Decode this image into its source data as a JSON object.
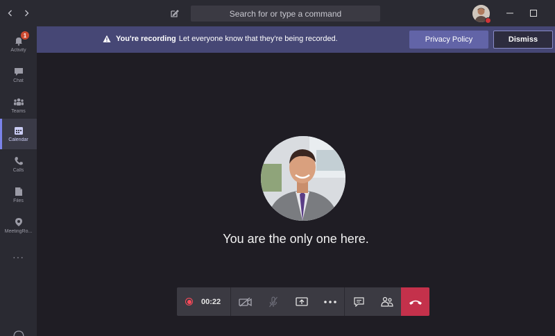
{
  "titlebar": {
    "search_placeholder": "Search for or type a command"
  },
  "rail": {
    "items": [
      {
        "label": "Activity",
        "icon": "bell-icon",
        "badge": "1"
      },
      {
        "label": "Chat",
        "icon": "chat-icon"
      },
      {
        "label": "Teams",
        "icon": "teams-icon"
      },
      {
        "label": "Calendar",
        "icon": "calendar-icon",
        "active": true
      },
      {
        "label": "Calls",
        "icon": "phone-icon"
      },
      {
        "label": "Files",
        "icon": "file-icon"
      },
      {
        "label": "MeetingRo...",
        "icon": "location-pin-icon"
      }
    ],
    "more_label": "···"
  },
  "banner": {
    "title": "You're recording",
    "message": "Let everyone know that they're being recorded.",
    "privacy_label": "Privacy Policy",
    "dismiss_label": "Dismiss",
    "color": "#464775"
  },
  "stage": {
    "status_text": "You are the only one here."
  },
  "controls": {
    "timer": "00:22",
    "hangup_color": "#c4314b",
    "recording_color": "#ff4a5a"
  }
}
